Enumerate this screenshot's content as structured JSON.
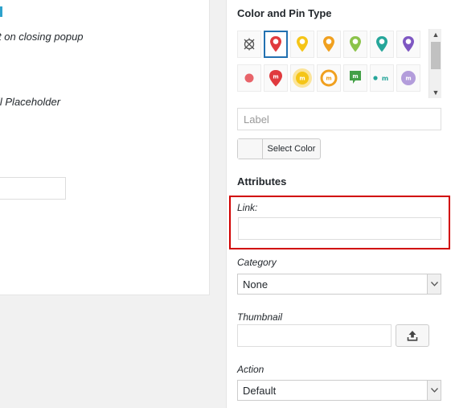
{
  "left_panel": {
    "text_1": "t on closing popup",
    "text_2": "il Placeholder"
  },
  "right_panel": {
    "color_pin_title": "Color and Pin Type",
    "pin_icons": [
      "crosshair-icon",
      "pin-red-icon",
      "pin-yellow-icon",
      "pin-orange-icon",
      "pin-green-icon",
      "pin-teal-icon",
      "pin-purple-icon",
      "dot-red-icon",
      "pin-m-red-icon",
      "circle-m-yellow-icon",
      "ring-m-orange-icon",
      "chat-m-green-icon",
      "dot-m-teal-icon",
      "circle-m-lavender-icon"
    ],
    "label_placeholder": "Label",
    "select_color_label": "Select Color",
    "attributes_title": "Attributes",
    "link_label": "Link:",
    "link_value": "",
    "category_label": "Category",
    "category_value": "None",
    "thumbnail_label": "Thumbnail",
    "thumbnail_value": "",
    "action_label": "Action",
    "action_value": "Default"
  },
  "colors": {
    "highlight_border": "#d10000",
    "selected_pin_border": "#2271b1",
    "pin_red": "#e03a3e",
    "pin_yellow": "#f5c518",
    "pin_orange": "#f0a01f",
    "pin_green": "#8bc34a",
    "pin_teal": "#26a69a",
    "pin_purple": "#7e57c2"
  }
}
